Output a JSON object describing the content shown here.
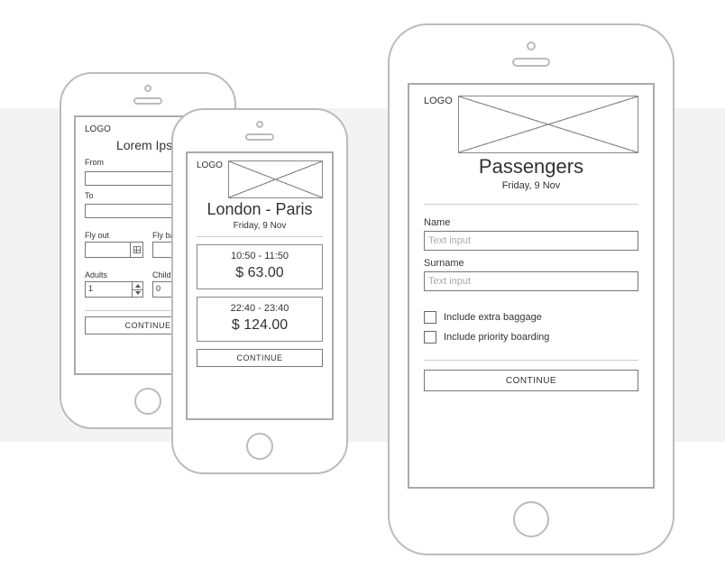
{
  "screenA": {
    "logo": "LOGO",
    "title": "Lorem Ipsu",
    "from_label": "From",
    "to_label": "To",
    "flyout_label": "Fly out",
    "flyback_label": "Fly back",
    "adults_label": "Adults",
    "children_label": "Childre",
    "adults_value": "1",
    "children_value": "0",
    "continue": "CONTINUE"
  },
  "screenB": {
    "logo": "LOGO",
    "route": "London - Paris",
    "date": "Friday, 9 Nov",
    "flights": [
      {
        "time": "10:50 - 11:50",
        "price": "$ 63.00"
      },
      {
        "time": "22:40 - 23:40",
        "price": "$ 124.00"
      }
    ],
    "continue": "CONTINUE"
  },
  "screenC": {
    "logo": "LOGO",
    "title": "Passengers",
    "date": "Friday, 9 Nov",
    "name_label": "Name",
    "surname_label": "Surname",
    "input_placeholder": "Text input",
    "extra_baggage": "Include extra baggage",
    "priority_boarding": "Include priority boarding",
    "continue": "CONTINUE"
  }
}
